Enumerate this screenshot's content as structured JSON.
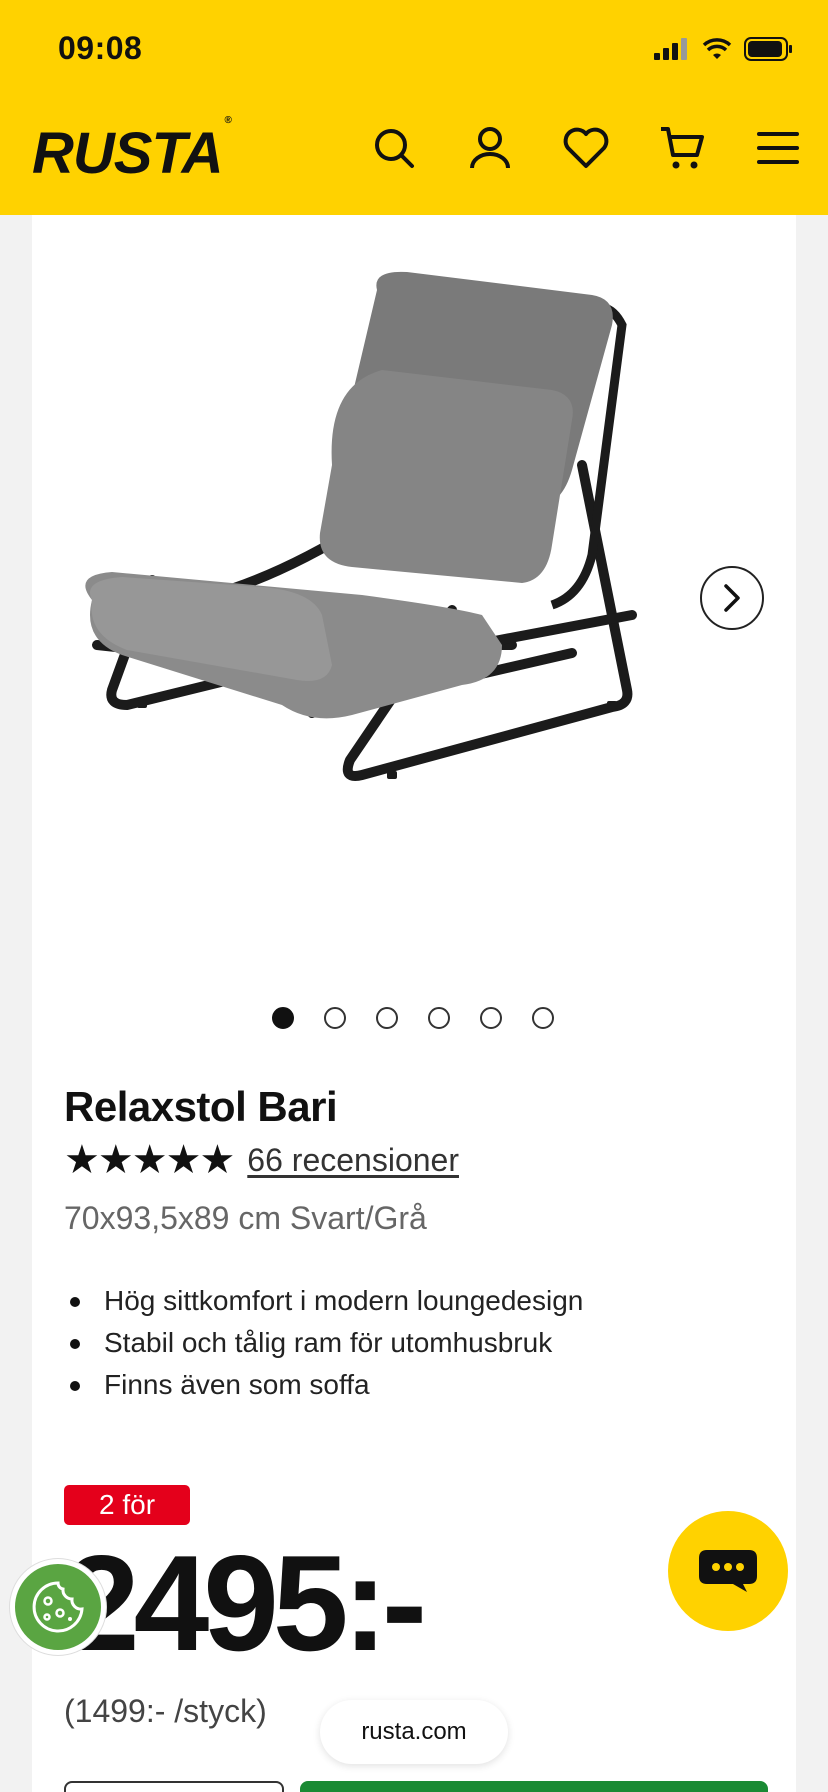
{
  "status_bar": {
    "time": "09:08",
    "icons": [
      "signal-icon",
      "wifi-icon",
      "battery-icon"
    ]
  },
  "header": {
    "logo": "RUSTA",
    "icons": [
      "search-icon",
      "account-icon",
      "heart-icon",
      "cart-icon",
      "menu-icon"
    ],
    "background_color": "#ffd200"
  },
  "gallery": {
    "image": "gray-lounge-chair-photo",
    "next_icon": "chevron-right-icon",
    "slide_count": 6,
    "active_slide": 1
  },
  "product": {
    "title": "Relaxstol Bari",
    "stars": "★★★★★",
    "reviews_link": "66 recensioner",
    "spec": "70x93,5x89 cm Svart/Grå",
    "bullets": [
      "Hög sittkomfort i modern loungedesign",
      "Stabil och tålig ram för utomhusbruk",
      "Finns även som soffa"
    ]
  },
  "pricing": {
    "badge": "2 för",
    "price": "2495:-",
    "unit_price": "(1499:- /styck)",
    "badge_color": "#e4001b",
    "buy_color": "#1a8a34"
  },
  "floating": {
    "chat_icon": "chat-bubble-icon",
    "cookie_icon": "cookie-icon",
    "url": "rusta.com"
  }
}
